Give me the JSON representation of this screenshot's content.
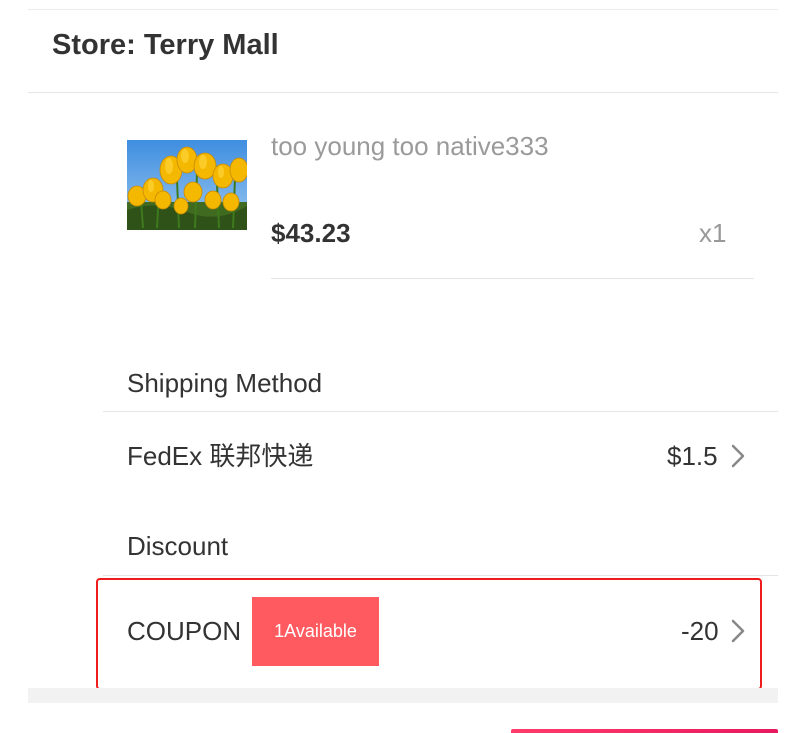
{
  "store": {
    "title": "Store: Terry Mall"
  },
  "product": {
    "image_icon": "tulip-photo",
    "name": "too young too native333",
    "price": "$43.23",
    "quantity": "x1"
  },
  "shipping": {
    "heading": "Shipping Method",
    "method": "FedEx 联邦快递",
    "price": "$1.5",
    "chevron_icon": "chevron-right-icon"
  },
  "discount": {
    "heading": "Discount",
    "coupon_label": "COUPON",
    "badge": "1Available",
    "value": "-20",
    "chevron_icon": "chevron-right-icon"
  },
  "colors": {
    "badge_bg": "#ff5a5f",
    "highlight_border": "#ee1c1c",
    "accent_bar": "#e8195f"
  }
}
